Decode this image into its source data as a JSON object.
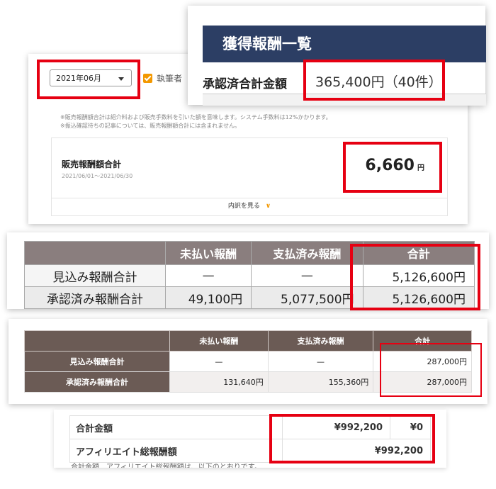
{
  "card1": {
    "month_select": "2021年06月",
    "checkbox_label": "執筆者",
    "notes": [
      "※販売報酬額合計は紹介料および販売手数料を引いた額を意味します。システム手数料は12%かかります。",
      "※振込確認待ちの記事については、販売報酬額合計には含まれません。"
    ],
    "summary_title": "販売報酬額合計",
    "summary_period": "2021/06/01〜2021/06/30",
    "summary_amount": "6,660",
    "summary_unit": "円",
    "breakdown_label": "内訳を見る"
  },
  "card2": {
    "header": "獲得報酬一覧",
    "total_label": "承認済合計金額",
    "total_value": "365,400円（40件）"
  },
  "table1": {
    "headers": [
      "",
      "未払い報酬",
      "支払済み報酬",
      "合計"
    ],
    "rows": [
      [
        "見込み報酬合計",
        "—",
        "—",
        "5,126,600円"
      ],
      [
        "承認済み報酬合計",
        "49,100円",
        "5,077,500円",
        "5,126,600円"
      ]
    ]
  },
  "table2": {
    "headers": [
      "",
      "未払い報酬",
      "支払済み報酬",
      "合計"
    ],
    "rows": [
      [
        "見込み報酬合計",
        "—",
        "—",
        "287,000円"
      ],
      [
        "承認済み報酬合計",
        "131,640円",
        "155,360円",
        "287,000円"
      ]
    ]
  },
  "table3": {
    "row1_label": "合計金額",
    "row1_value1": "¥992,200",
    "row1_value2": "¥0",
    "row2_label": "アフィリエイト総報酬額",
    "row2_value": "¥992,200",
    "cut_text": "合計金額…アフィリエイト総報酬額は、以下のとおりです。"
  },
  "colors": {
    "highlight": "#e60012",
    "accent_orange": "#f39800",
    "navy_header": "#2c3e64",
    "table1_header": "#8a7e7e",
    "table2_header": "#6b5b55"
  }
}
